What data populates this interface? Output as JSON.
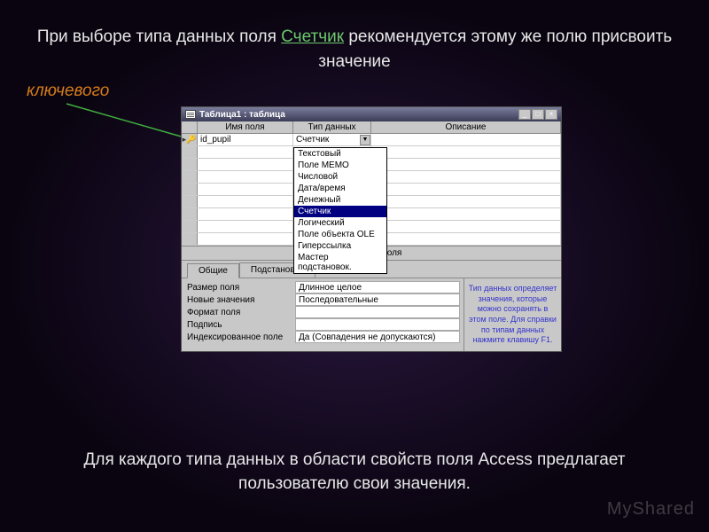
{
  "slide": {
    "text_top_1": "При выборе типа данных поля",
    "highlight": "Счетчик",
    "text_top_2": "рекомендуется этому же полю присвоить значение",
    "key_label": "ключевого",
    "text_bottom": "Для каждого типа данных в области свойств поля Access предлагает пользователю свои значения."
  },
  "window": {
    "title": "Таблица1 : таблица",
    "columns": {
      "name": "Имя поля",
      "type": "Тип данных",
      "desc": "Описание"
    },
    "row1": {
      "field": "id_pupil",
      "type": "Счетчик"
    },
    "dropdown": [
      "Текстовый",
      "Поле МЕМО",
      "Числовой",
      "Дата/время",
      "Денежный",
      "Счетчик",
      "Логический",
      "Поле объекта OLE",
      "Гиперссылка",
      "Мастер подстановок."
    ],
    "dropdown_selected_index": 5,
    "props_header": "Свойства поля",
    "tabs": {
      "general": "Общие",
      "lookup": "Подстановка"
    },
    "props": [
      {
        "label": "Размер поля",
        "value": "Длинное целое"
      },
      {
        "label": "Новые значения",
        "value": "Последовательные"
      },
      {
        "label": "Формат поля",
        "value": ""
      },
      {
        "label": "Подпись",
        "value": ""
      },
      {
        "label": "Индексированное поле",
        "value": "Да (Совпадения не допускаются)"
      }
    ],
    "help_text": "Тип данных определяет значения, которые можно сохранять в этом поле. Для справки по типам данных нажмите клавишу F1."
  },
  "watermark": "MyShared"
}
